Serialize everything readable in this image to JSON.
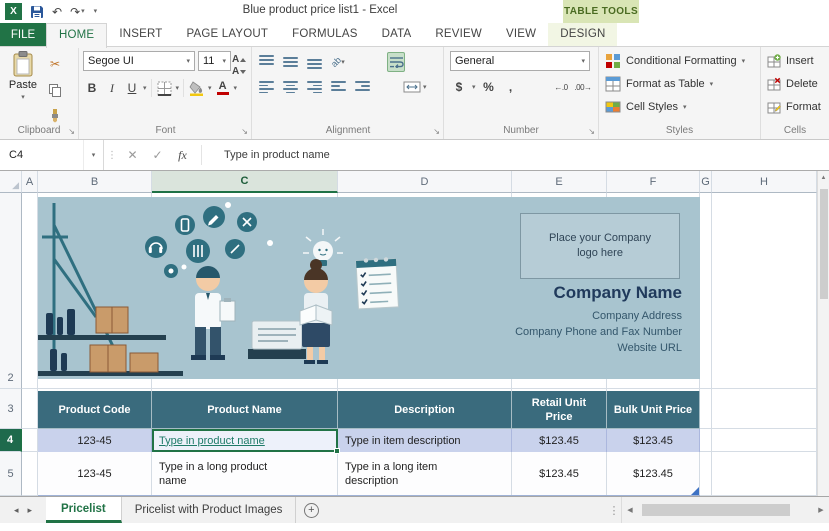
{
  "title_bar": {
    "title": "Blue product price list1 - Excel",
    "contextual_label": "TABLE TOOLS"
  },
  "ribbon_tabs": {
    "file": "FILE",
    "home": "HOME",
    "insert": "INSERT",
    "page_layout": "PAGE LAYOUT",
    "formulas": "FORMULAS",
    "data": "DATA",
    "review": "REVIEW",
    "view": "VIEW",
    "design": "DESIGN"
  },
  "ribbon": {
    "clipboard": {
      "group_label": "Clipboard",
      "paste": "Paste"
    },
    "font": {
      "group_label": "Font",
      "name": "Segoe UI",
      "size": "11",
      "bold": "B",
      "italic": "I",
      "underline": "U",
      "letter": "A"
    },
    "alignment": {
      "group_label": "Alignment"
    },
    "number": {
      "group_label": "Number",
      "format": "General",
      "currency": "$",
      "percent": "%",
      "comma": ","
    },
    "styles": {
      "group_label": "Styles",
      "conditional_formatting": "Conditional Formatting",
      "format_as_table": "Format as Table",
      "cell_styles": "Cell Styles"
    },
    "cells": {
      "group_label": "Cells",
      "insert": "Insert",
      "delete": "Delete",
      "format": "Format"
    }
  },
  "formula_bar": {
    "name_box": "C4",
    "fx_label": "fx",
    "content": "Type in product name"
  },
  "grid": {
    "columns": [
      "A",
      "B",
      "C",
      "D",
      "E",
      "F",
      "G",
      "H"
    ],
    "rows": [
      "2",
      "3",
      "4",
      "5"
    ],
    "selected_cell": "C4"
  },
  "worksheet": {
    "logo_placeholder": "Place your Company logo here",
    "company_name": "Company Name",
    "company_address": "Company Address",
    "company_phone": "Company Phone and Fax Number",
    "company_website": "Website URL",
    "table": {
      "headers": [
        "Product Code",
        "Product Name",
        "Description",
        "Retail Unit Price",
        "Bulk Unit Price"
      ],
      "rows": [
        {
          "code": "123-45",
          "name": "Type in product name",
          "description": "Type in item description",
          "retail_price": "$123.45",
          "bulk_price": "$123.45"
        },
        {
          "code": "123-45",
          "name": "Type in a long product name",
          "description": "Type in a long item description",
          "retail_price": "$123.45",
          "bulk_price": "$123.45"
        }
      ]
    }
  },
  "sheet_tabs": {
    "active": "Pricelist",
    "inactive": "Pricelist with Product Images"
  },
  "icons": {
    "excel_logo": "X",
    "undo": "↶",
    "redo": "↷",
    "dropdown_arrow": "▾",
    "cut": "✂",
    "dots_handle": "⋮",
    "cancel": "✕",
    "enter": "✓",
    "select_all": "◢",
    "scroll_up": "▲",
    "scroll_left": "◀",
    "scroll_right": "▶",
    "tab_prev": "◂",
    "tab_next": "▸",
    "new_sheet": "+",
    "launcher": "↘",
    "orientation": "ab",
    "increase_decimal": "←.0",
    "decrease_decimal": ".00→"
  },
  "colors": {
    "excel_green": "#217346",
    "table_header_teal": "#3A6B7D",
    "banded_row_blue": "#C9D2EC",
    "illustration_bg": "#A8C4CF",
    "contextual_tab_bg": "#D9E5B5"
  }
}
